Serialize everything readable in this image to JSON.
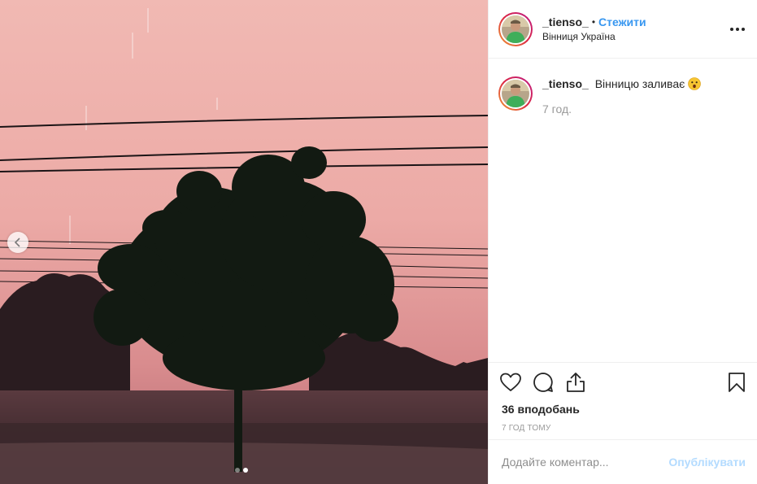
{
  "media": {
    "prev_icon": "chevron-left-icon",
    "carousel": {
      "count": 2,
      "active_index": 1
    }
  },
  "header": {
    "username": "_tienso_",
    "separator": "•",
    "follow_label": "Стежити",
    "location": "Вінниця Україна",
    "more_icon": "more-horizontal-icon"
  },
  "caption": {
    "username": "_tienso_",
    "text": "Вінницю заливає",
    "emoji": "astonished-face-emoji",
    "time": "7 год."
  },
  "actions": {
    "like_icon": "heart-icon",
    "comment_icon": "comment-icon",
    "share_icon": "share-icon",
    "save_icon": "bookmark-icon"
  },
  "likes": "36 вподобань",
  "post_time": "7 ГОД ТОМУ",
  "comment_box": {
    "placeholder": "Додайте коментар...",
    "post_label": "Опублікувати"
  },
  "colors": {
    "follow": "#3897f0",
    "post_button_disabled": "#b3dbff",
    "muted_text": "#999999",
    "border": "#efefef"
  }
}
